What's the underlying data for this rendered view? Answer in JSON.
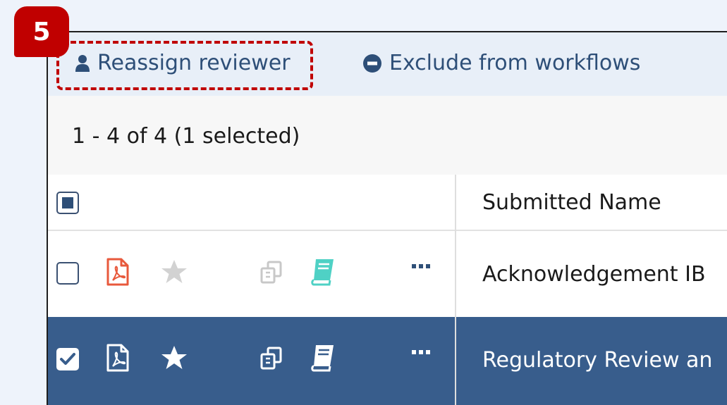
{
  "step_badge": "5",
  "toolbar": {
    "reassign_label": "Reassign reviewer",
    "exclude_label": "Exclude from workflows"
  },
  "summary": {
    "count_text": "1 - 4 of 4 (1 selected)"
  },
  "table": {
    "columns": [
      "Submitted Name"
    ],
    "rows": [
      {
        "submitted_name": "Acknowledgement IB",
        "selected": false
      },
      {
        "submitted_name": "Regulatory Review an",
        "selected": true
      }
    ]
  },
  "colors": {
    "accent": "#2e4f78",
    "selected_row": "#385d8c",
    "highlight": "#c00000",
    "pdf_icon": "#e8593c",
    "book_icon": "#4fd1c5",
    "star_inactive": "#d2d2d2"
  }
}
